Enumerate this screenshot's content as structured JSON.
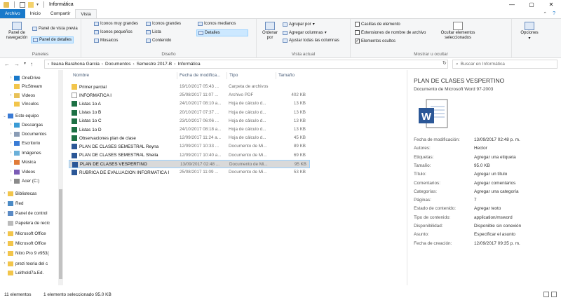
{
  "window": {
    "title": "Informática",
    "controls": [
      "—",
      "▢",
      "✕"
    ]
  },
  "ribbon_tabs": [
    "Archivo",
    "Inicio",
    "Compartir",
    "Vista"
  ],
  "ribbon": {
    "paneles": {
      "label": "Paneles",
      "nav_pane": "Panel de navegación",
      "preview_pane": "Panel de vista previa",
      "details_pane": "Panel de detalles"
    },
    "diseno": {
      "label": "Diseño",
      "options": [
        "Iconos muy grandes",
        "Iconos grandes",
        "Iconos medianos",
        "Iconos pequeños",
        "Lista",
        "Detalles",
        "Mosaicos",
        "Contenido"
      ]
    },
    "vista_actual": {
      "label": "Vista actual",
      "ordenar_por": "Ordenar por",
      "agrupar_por": "Agrupar por",
      "agregar_columnas": "Agregar columnas",
      "ajustar": "Ajustar todas las columnas"
    },
    "mostrar": {
      "label": "Mostrar u ocultar",
      "casillas": "Casillas de elemento",
      "extensiones": "Extensiones de nombre de archivo",
      "ocultos": "Elementos ocultos",
      "ocultar_sel": "Ocultar elementos seleccionados",
      "opciones": "Opciones"
    }
  },
  "address": {
    "crumbs": [
      "Ileana Barahona Garcia",
      "Documentos",
      "Semestre 2017-B",
      "Informática"
    ],
    "search_placeholder": "Buscar en Informática"
  },
  "nav_pane": [
    "OneDrive",
    "PicStream",
    "Videos",
    "Vínculos",
    "Este equipo",
    "Descargas",
    "Documentos",
    "Escritorio",
    "Imágenes",
    "Música",
    "Videos",
    "Acer (C:)",
    "Bibliotecas",
    "Red",
    "Panel de control",
    "Papelera de recic",
    "Microsoft Office",
    "Microsoft Office",
    "Nitro Pro 9 v953(",
    "prezi teoria del c",
    "Leithold7a.Ed."
  ],
  "columns": {
    "name": "Nombre",
    "date": "Fecha de modifica...",
    "type": "Tipo",
    "size": "Tamaño"
  },
  "files": [
    {
      "name": "Primer parcial",
      "date": "19/10/2017 05:43 ...",
      "type": "Carpeta de archivos",
      "size": "",
      "icon": "folder"
    },
    {
      "name": "INFORMATICA I",
      "date": "25/08/2017 11:07 ...",
      "type": "Archivo PDF",
      "size": "402 KB",
      "icon": "pdf"
    },
    {
      "name": "Listas 1o A",
      "date": "24/10/2017 08:10 a...",
      "type": "Hoja de cálculo d...",
      "size": "13 KB",
      "icon": "excel"
    },
    {
      "name": "Listas 1o B",
      "date": "20/10/2017 07:37 ...",
      "type": "Hoja de cálculo d...",
      "size": "13 KB",
      "icon": "excel"
    },
    {
      "name": "Listas 1o C",
      "date": "23/10/2017 06:06 ...",
      "type": "Hoja de cálculo d...",
      "size": "13 KB",
      "icon": "excel"
    },
    {
      "name": "Listas 1o D",
      "date": "24/10/2017 08:18 a...",
      "type": "Hoja de cálculo d...",
      "size": "13 KB",
      "icon": "excel"
    },
    {
      "name": "Observaciones plan de clase",
      "date": "12/09/2017 11:24 a...",
      "type": "Hoja de cálculo d...",
      "size": "45 KB",
      "icon": "excel"
    },
    {
      "name": "PLAN DE CLASES SEMESTRAL Reyna",
      "date": "12/09/2017 10:33 ...",
      "type": "Documento de Mi...",
      "size": "89 KB",
      "icon": "word"
    },
    {
      "name": "PLAN DE CLASES SEMESTRAL Sheila",
      "date": "12/09/2017 10:40 a...",
      "type": "Documento de Mi...",
      "size": "69 KB",
      "icon": "word"
    },
    {
      "name": "PLAN DE CLASES VESPERTINO",
      "date": "13/09/2017 02:48 ...",
      "type": "Documento de Mi...",
      "size": "95 KB",
      "icon": "word",
      "selected": true
    },
    {
      "name": "RUBRICA DE EVALUACION INFORMATICA I",
      "date": "25/08/2017 11:09 ...",
      "type": "Documento de Mi...",
      "size": "53 KB",
      "icon": "word"
    }
  ],
  "details": {
    "title": "PLAN DE CLASES VESPERTINO",
    "subtitle": "Documento de Microsoft Word 97-2003",
    "props": [
      {
        "k": "Fecha de modificación:",
        "v": "13/09/2017 02:48 p. m."
      },
      {
        "k": "Autores:",
        "v": "Hector"
      },
      {
        "k": "Etiquetas:",
        "v": "Agregar una etiqueta"
      },
      {
        "k": "Tamaño:",
        "v": "95.0 KB"
      },
      {
        "k": "Título:",
        "v": "Agregar un título"
      },
      {
        "k": "Comentarios:",
        "v": "Agregar comentarios"
      },
      {
        "k": "Categorías:",
        "v": "Agregar una categoría"
      },
      {
        "k": "Páginas:",
        "v": "7"
      },
      {
        "k": "Estado de contenido:",
        "v": "Agregar texto"
      },
      {
        "k": "Tipo de contenido:",
        "v": "application/msword"
      },
      {
        "k": "Disponibilidad:",
        "v": "Disponible sin conexión"
      },
      {
        "k": "Asunto:",
        "v": "Especificar el asunto"
      },
      {
        "k": "Fecha de creación:",
        "v": "12/09/2017 09:35 p. m."
      }
    ]
  },
  "status": {
    "count": "11 elementos",
    "selection": "1 elemento seleccionado  95.0 KB"
  }
}
